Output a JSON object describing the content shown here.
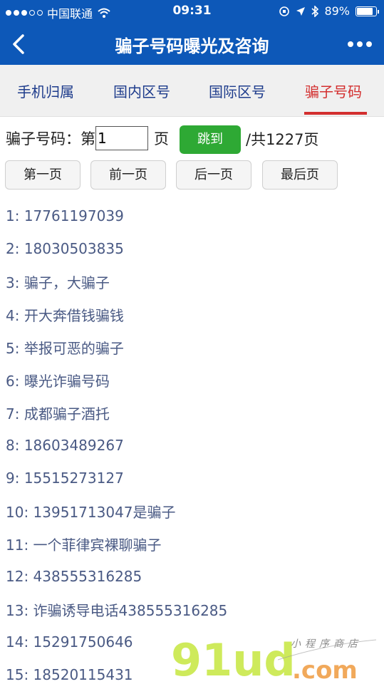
{
  "status_bar": {
    "carrier": "中国联通",
    "time": "09:31",
    "battery": "89%",
    "battery_level": 0.89
  },
  "header": {
    "title": "骗子号码曝光及咨询"
  },
  "tabs": [
    {
      "label": "手机归属",
      "active": false
    },
    {
      "label": "国内区号",
      "active": false
    },
    {
      "label": "国际区号",
      "active": false
    },
    {
      "label": "骗子号码",
      "active": true
    }
  ],
  "pager": {
    "label": "骗子号码：第",
    "page_value": "1",
    "page_unit": "页",
    "go_button": "跳到",
    "total": "/共1227页"
  },
  "nav_buttons": {
    "first": "第一页",
    "prev": "前一页",
    "next": "后一页",
    "last": "最后页"
  },
  "entries": [
    "1: 17761197039",
    "2: 18030503835",
    "3: 骗子，大骗子",
    "4: 开大奔借钱骗钱",
    "5: 举报可恶的骗子",
    "6: 曝光诈骗号码",
    "7: 成都骗子酒托",
    "8: 18603489267",
    "9: 15515273127",
    "10: 13951713047是骗子",
    "11: 一个菲律宾裸聊骗子",
    "12: 438555316285",
    "13: 诈骗诱导电话438555316285",
    "14: 15291750646",
    "15: 18520115431"
  ],
  "watermark": {
    "logo_text": "91ud.com",
    "tagline": "小程序商店"
  },
  "colors": {
    "header_bg": "#0d58b8",
    "tab_text": "#1e3c8c",
    "tab_active": "#d32f2f",
    "go_button_bg": "#2ea934",
    "entry_text": "#4a5a84"
  }
}
